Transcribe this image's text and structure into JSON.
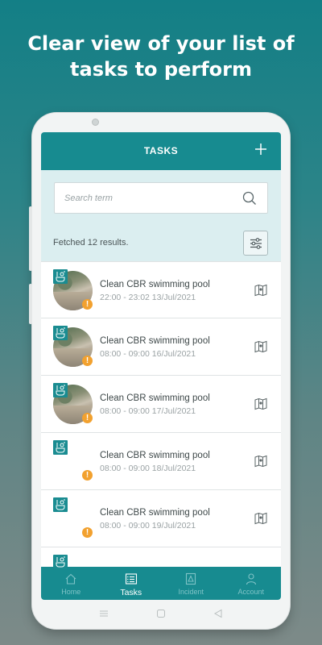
{
  "headline": {
    "line1": "Clear view of your list of",
    "line2": "tasks to perform"
  },
  "appbar": {
    "title": "TASKS",
    "add_icon": "plus-icon"
  },
  "search": {
    "placeholder": "Search term",
    "value": "",
    "icon": "search-icon"
  },
  "results_text": "Fetched 12 results.",
  "filter_icon": "sliders-icon",
  "tasks": [
    {
      "title": "Clean CBR swimming pool",
      "time": "22:00 - 23:02 13/Jul/2021",
      "has_photo": true,
      "warning": "!"
    },
    {
      "title": "Clean CBR swimming pool",
      "time": "08:00 - 09:00 16/Jul/2021",
      "has_photo": true,
      "warning": "!"
    },
    {
      "title": "Clean CBR swimming pool",
      "time": "08:00 - 09:00 17/Jul/2021",
      "has_photo": true,
      "warning": "!"
    },
    {
      "title": "Clean CBR swimming pool",
      "time": "08:00 - 09:00 18/Jul/2021",
      "has_photo": false,
      "warning": "!"
    },
    {
      "title": "Clean CBR swimming pool",
      "time": "08:00 - 09:00 19/Jul/2021",
      "has_photo": false,
      "warning": "!"
    }
  ],
  "bottom_nav": [
    {
      "label": "Home",
      "icon": "home-icon",
      "active": false
    },
    {
      "label": "Tasks",
      "icon": "task-list-icon",
      "active": true
    },
    {
      "label": "Incident",
      "icon": "incident-icon",
      "active": false
    },
    {
      "label": "Account",
      "icon": "account-icon",
      "active": false
    }
  ],
  "colors": {
    "primary": "#178b90",
    "toparea": "#dbeef0",
    "warning": "#f2a12f",
    "nav_inactive": "#7fc3c7"
  }
}
